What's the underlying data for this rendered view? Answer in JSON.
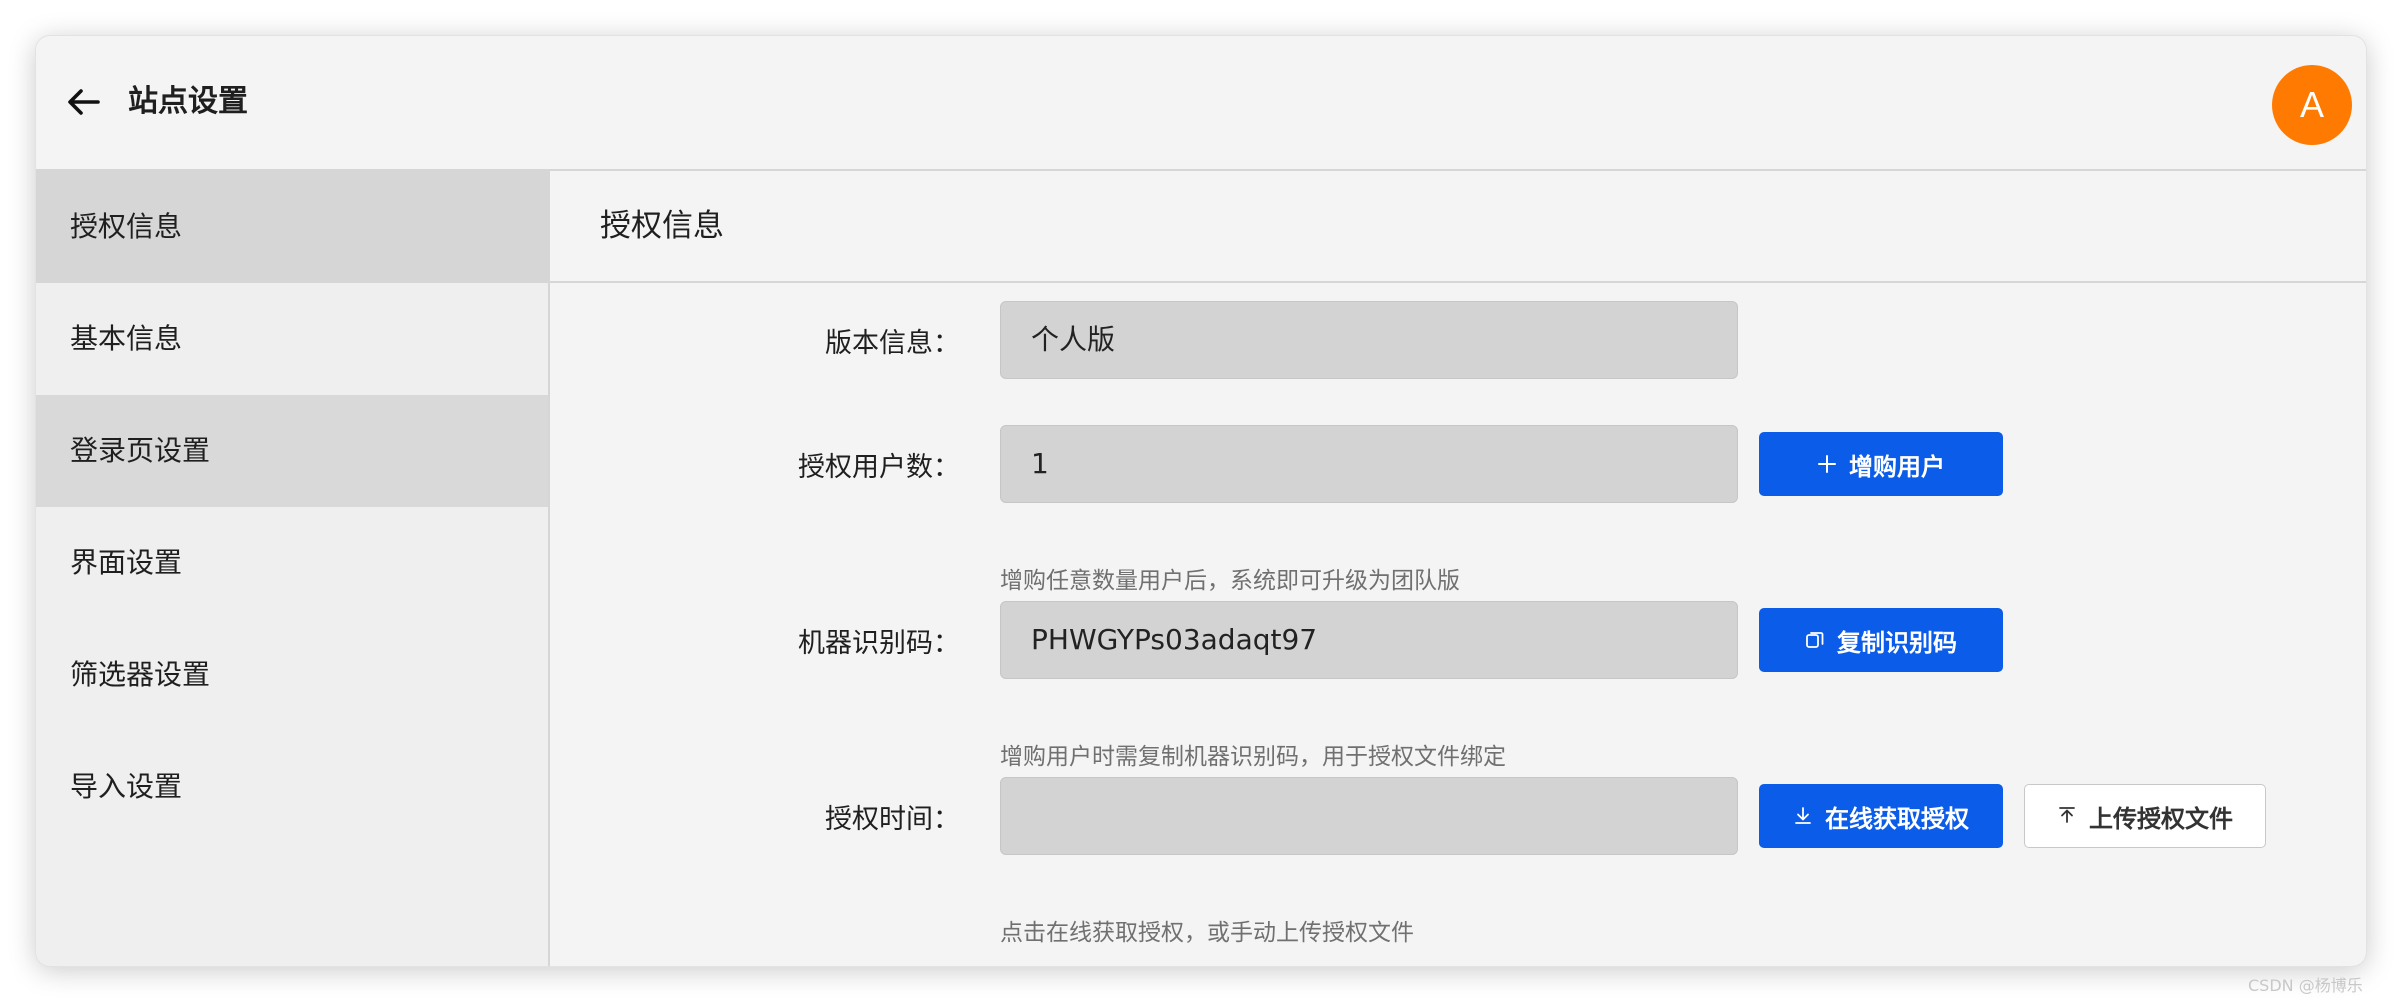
{
  "header": {
    "title": "站点设置",
    "avatar_letter": "A"
  },
  "sidebar": {
    "items": [
      {
        "label": "授权信息"
      },
      {
        "label": "基本信息"
      },
      {
        "label": "登录页设置"
      },
      {
        "label": "界面设置"
      },
      {
        "label": "筛选器设置"
      },
      {
        "label": "导入设置"
      }
    ]
  },
  "main": {
    "title": "授权信息",
    "fields": {
      "version": {
        "label": "版本信息：",
        "value": "个人版"
      },
      "users": {
        "label": "授权用户数：",
        "value": "1",
        "hint": "增购任意数量用户后，系统即可升级为团队版",
        "button": "增购用户"
      },
      "machine": {
        "label": "机器识别码：",
        "value": "PHWGYPs03adaqt97",
        "hint": "增购用户时需复制机器识别码，用于授权文件绑定",
        "button": "复制识别码"
      },
      "time": {
        "label": "授权时间：",
        "value": "",
        "hint": "点击在线获取授权，或手动上传授权文件",
        "button_online": "在线获取授权",
        "button_upload": "上传授权文件"
      }
    }
  },
  "watermark": "CSDN @杨博乐",
  "colors": {
    "primary": "#0b5ce8",
    "avatar": "#ff7a00"
  }
}
